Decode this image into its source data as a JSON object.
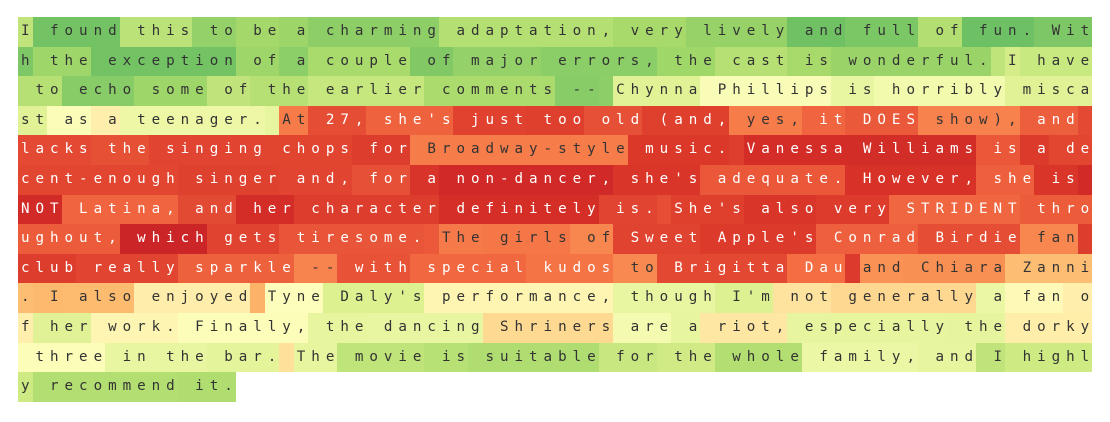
{
  "text": "I found this to be a charming adaptation, very lively and full of fun. With the exception of a couple of major errors, the cast is wonderful. I have to echo some of the earlier comments -- Chynna Phillips is horribly miscast as a teenager. At 27, she's just too old (and, yes, it DOES show), and lacks the singing chops for Broadway-style music. Vanessa Williams is a decent-enough singer and, for a non-dancer, she's adequate. However, she is NOT Latina, and her character definitely is. She's also very STRIDENT throughout, which gets tiresome. The girls of Sweet Apple's Conrad Birdie fan club really sparkle -- with special kudos to Brigitta Dau and Chiara Zanni. I also enjoyed Tyne Daly's performance, though I'm not generally a fan of her work. Finally, the dancing Shriners are a riot, especially the dorky three in the bar. The movie is suitable for the whole family, and I highly recommend it.",
  "segments": [
    {
      "text": "I found this to be a charming adaptation, very lively and full of fun. With the exception of a couple of major errors, the cast is wonderful. ",
      "score": 0.55
    },
    {
      "text": "I have to echo some of the earlier comments -- ",
      "score": 0.45
    },
    {
      "text": "Chynna Phillips is horribly miscast as a teenager. ",
      "score": 0.05
    },
    {
      "text": "At 27, she's just too old (and, yes, it DOES show), and lacks the singing chops for Broadway-style music. ",
      "score": -0.55
    },
    {
      "text": "Vanessa Williams is a decent-enough singer and, for a non-dancer, she's adequate. However, she is NOT Latina, and her character definitely is. ",
      "score": -0.62
    },
    {
      "text": "She's also very STRIDENT throughout, which gets tiresome. ",
      "score": -0.68
    },
    {
      "text": "The girls of Sweet Apple's Conrad Birdie fan club really sparkle -- with special kudos to Brigitta Dau ",
      "score": -0.55
    },
    {
      "text": "and Chiara Zanni. I also enjoyed ",
      "score": -0.2
    },
    {
      "text": "Tyne Daly's performance, though I'm not generally a fan of her work. Finally, the dancing Shriners are a riot, especially the dorky three in the bar. ",
      "score": 0.05
    },
    {
      "text": "The movie is suitable for the whole family, and I highly recommend it.",
      "score": 0.3
    }
  ],
  "colors": {
    "strong_positive": "#1a9850",
    "positive": "#66bd63",
    "light_positive": "#d9ef8b",
    "neutral": "#ffffbf",
    "light_negative": "#fdae61",
    "negative": "#f46d43",
    "strong_negative": "#d73027",
    "darkest_negative": "#a50026"
  }
}
